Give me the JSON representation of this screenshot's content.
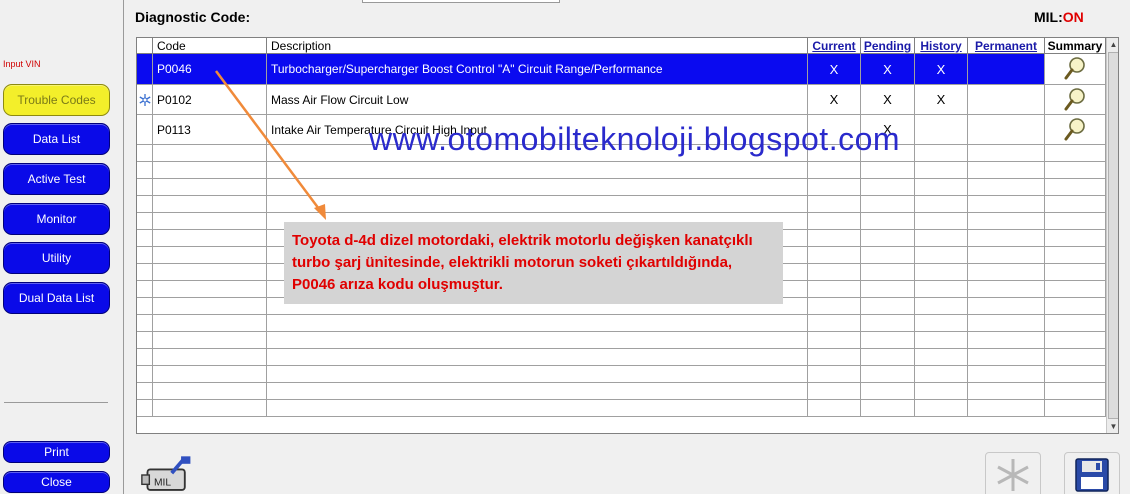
{
  "sidebar": {
    "input_vin_label": "Input VIN",
    "buttons": [
      {
        "label": "Trouble Codes",
        "active": true
      },
      {
        "label": "Data List"
      },
      {
        "label": "Active Test"
      },
      {
        "label": "Monitor"
      },
      {
        "label": "Utility"
      },
      {
        "label": "Dual Data List"
      }
    ],
    "print_label": "Print",
    "close_label": "Close"
  },
  "header": {
    "diagnostic_code_label": "Diagnostic Code:",
    "mil_label": "MIL:",
    "mil_state": "ON"
  },
  "table": {
    "columns": [
      "Code",
      "Description",
      "Current",
      "Pending",
      "History",
      "Permanent",
      "Summary"
    ],
    "rows": [
      {
        "code": "P0046",
        "description": "Turbocharger/Supercharger Boost Control \"A\" Circuit Range/Performance",
        "current": "X",
        "pending": "X",
        "history": "X",
        "permanent": "",
        "selected": true
      },
      {
        "code": "P0102",
        "description": "Mass Air Flow Circuit Low",
        "current": "X",
        "pending": "X",
        "history": "X",
        "permanent": ""
      },
      {
        "code": "P0113",
        "description": "Intake Air Temperature Circuit High Input",
        "current": "",
        "pending": "X",
        "history": "",
        "permanent": ""
      }
    ]
  },
  "watermark": "www.otomobilteknoloji.blogspot.com",
  "annotation": "Toyota d-4d dizel motordaki, elektrik motorlu değişken kanatçıklı turbo şarj ünitesinde, elektrikli motorun soketi çıkartıldığında, P0046 arıza kodu oluşmuştur.",
  "icons": {
    "freeze_frame": "snowflake-icon",
    "mil_engine": "engine-mil-icon",
    "save": "floppy-disk-icon",
    "summary": "magnifier-icon"
  },
  "colors": {
    "selected_row": "#0a0af0",
    "nav_button": "#0a0ae8",
    "active_button": "#f3ef2a",
    "mil_on": "#e00000",
    "annotation_text": "#e00000",
    "watermark": "#2a2acc"
  }
}
